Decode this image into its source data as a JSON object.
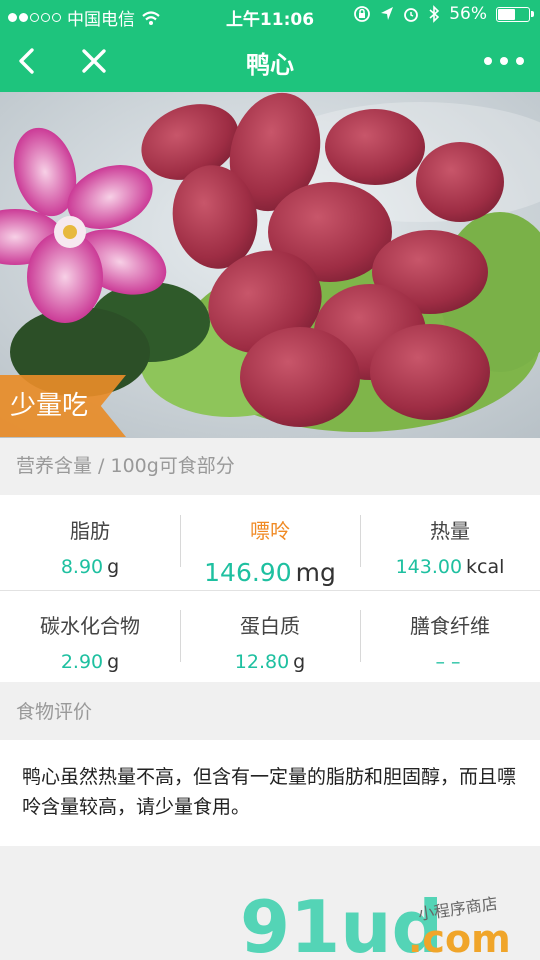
{
  "status_bar": {
    "carrier": "中国电信",
    "time": "上午11:06",
    "battery": "56%",
    "battery_level": 0.56
  },
  "nav": {
    "title": "鸭心"
  },
  "hero": {
    "tag": "少量吃"
  },
  "nutrition": {
    "header": "营养含量 / 100g可食部分",
    "items": [
      {
        "name": "脂肪",
        "value": "8.90",
        "unit": "g"
      },
      {
        "name": "嘌呤",
        "value": "146.90",
        "unit": "mg"
      },
      {
        "name": "热量",
        "value": "143.00",
        "unit": "kcal"
      },
      {
        "name": "碳水化合物",
        "value": "2.90",
        "unit": "g"
      },
      {
        "name": "蛋白质",
        "value": "12.80",
        "unit": "g"
      },
      {
        "name": "膳食纤维",
        "value": "– –",
        "unit": ""
      }
    ]
  },
  "evaluation": {
    "header": "食物评价",
    "text": "鸭心虽然热量不高，但含有一定量的脂肪和胆固醇，而且嘌呤含量较高，请少量食用。"
  },
  "watermark": {
    "logo": "91ud",
    "domain": ".com",
    "slogan": "小程序商店"
  }
}
